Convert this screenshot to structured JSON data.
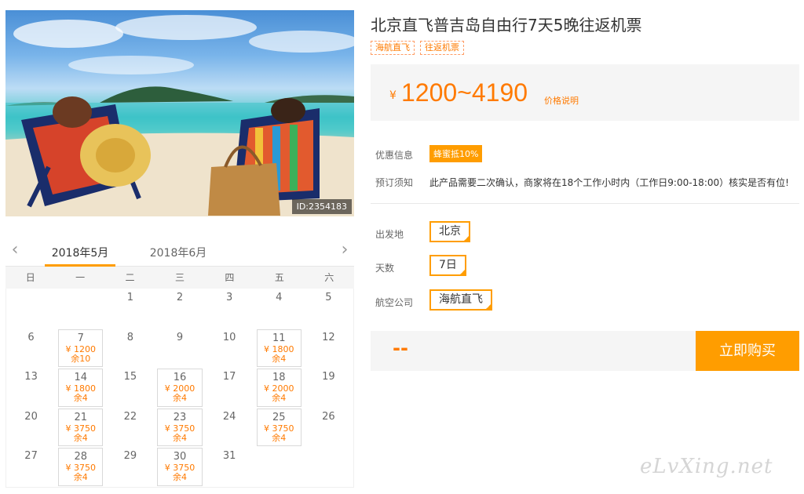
{
  "photo": {
    "id_label": "ID:2354183"
  },
  "product": {
    "title": "北京直飞普吉岛自由行7天5晚往返机票",
    "tags": [
      "海航直飞",
      "往返机票"
    ],
    "price_currency": "¥",
    "price_range": "1200~4190",
    "price_note": "价格说明"
  },
  "info": {
    "promo_label": "优惠信息",
    "promo_badge": "蜂蜜抵10%",
    "notice_label": "预订须知",
    "notice_text": "此产品需要二次确认，商家将在18个工作小时内（工作日9:00-18:00）核实是否有位!"
  },
  "options": {
    "departure_label": "出发地",
    "departure_value": "北京",
    "days_label": "天数",
    "days_value": "7日",
    "airline_label": "航空公司",
    "airline_value": "海航直飞"
  },
  "buy": {
    "total": "--",
    "button": "立即购买"
  },
  "calendar": {
    "months": [
      "2018年5月",
      "2018年6月"
    ],
    "weekdays": [
      "日",
      "一",
      "二",
      "三",
      "四",
      "五",
      "六"
    ],
    "weeks": [
      [
        {
          "d": ""
        },
        {
          "d": ""
        },
        {
          "d": "1"
        },
        {
          "d": "2"
        },
        {
          "d": "3"
        },
        {
          "d": "4"
        },
        {
          "d": "5"
        }
      ],
      [
        {
          "d": "6"
        },
        {
          "d": "7",
          "p": "¥ 1200",
          "s": "余10"
        },
        {
          "d": "8"
        },
        {
          "d": "9"
        },
        {
          "d": "10"
        },
        {
          "d": "11",
          "p": "¥ 1800",
          "s": "余4"
        },
        {
          "d": "12"
        }
      ],
      [
        {
          "d": "13"
        },
        {
          "d": "14",
          "p": "¥ 1800",
          "s": "余4"
        },
        {
          "d": "15"
        },
        {
          "d": "16",
          "p": "¥ 2000",
          "s": "余4"
        },
        {
          "d": "17"
        },
        {
          "d": "18",
          "p": "¥ 2000",
          "s": "余4"
        },
        {
          "d": "19"
        }
      ],
      [
        {
          "d": "20"
        },
        {
          "d": "21",
          "p": "¥ 3750",
          "s": "余4"
        },
        {
          "d": "22"
        },
        {
          "d": "23",
          "p": "¥ 3750",
          "s": "余4"
        },
        {
          "d": "24"
        },
        {
          "d": "25",
          "p": "¥ 3750",
          "s": "余4"
        },
        {
          "d": "26"
        }
      ],
      [
        {
          "d": "27"
        },
        {
          "d": "28",
          "p": "¥ 3750",
          "s": "余4"
        },
        {
          "d": "29"
        },
        {
          "d": "30",
          "p": "¥ 3750",
          "s": "余4"
        },
        {
          "d": "31"
        },
        {
          "d": ""
        },
        {
          "d": ""
        }
      ]
    ]
  },
  "watermark": "eLvXing.net"
}
